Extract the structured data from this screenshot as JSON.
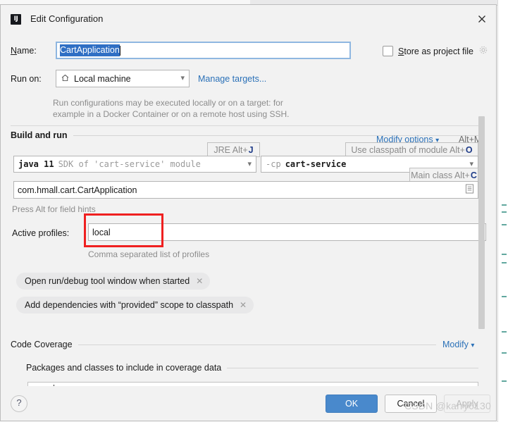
{
  "window": {
    "title": "Edit Configuration",
    "logo_text": "IJ",
    "close_icon": "close-icon"
  },
  "name_row": {
    "label_prefix": "N",
    "label_rest": "ame:",
    "value": "CartApplication",
    "placeholder": ""
  },
  "store_as_project_file": {
    "label_prefix": "S",
    "label_rest": "tore as project file",
    "checked": false,
    "gear_icon": "gear-icon"
  },
  "run_on": {
    "label": "Run on:",
    "value": "Local machine",
    "icon": "home-icon",
    "manage_targets_link": "Manage targets..."
  },
  "run_on_hint": {
    "line1": "Run configurations may be executed locally or on a target: for",
    "line2": "example in a Docker Container or on a remote host using SSH."
  },
  "build_and_run": {
    "section_title": "Build and run",
    "modify_options_link": "Modify options",
    "modify_options_shortcut": "Alt+M",
    "jre": {
      "bubble_label": "JRE Alt+",
      "bubble_key": "J",
      "value_bold": "java 11",
      "value_dim": "SDK of 'cart-service' module"
    },
    "classpath": {
      "bubble_label": "Use classpath of module Alt+",
      "bubble_key": "O",
      "value_dim": "-cp",
      "value_bold": "cart-service"
    },
    "main_class": {
      "bubble_label": "Main class Alt+",
      "bubble_key": "C",
      "value": "com.hmall.cart.CartApplication",
      "browse_icon": "document-browse-icon"
    },
    "field_hints": "Press Alt for field hints"
  },
  "active_profiles": {
    "label": "Active profiles:",
    "value": "local",
    "helper_text": "Comma separated list of profiles"
  },
  "chips": [
    {
      "label": "Open run/debug tool window when started",
      "remove_icon": "close-small-icon"
    },
    {
      "label": "Add dependencies with “provided” scope to classpath",
      "remove_icon": "close-small-icon"
    }
  ],
  "code_coverage": {
    "section_title": "Code Coverage",
    "modify_link": "Modify",
    "packages_label": "Packages and classes to include in coverage data"
  },
  "footer": {
    "help_label": "?",
    "ok_label": "OK",
    "cancel_label": "Cancel",
    "apply_label": "Apply"
  },
  "watermark": "CSDN @karry0130",
  "colors": {
    "accent_blue": "#4989cc",
    "link_blue": "#2b71b8",
    "selection_blue": "#2f6fc4",
    "annotation_red": "#ef2020",
    "dialog_bg": "#f2f2f2",
    "chip_bg": "#e8e8e9"
  }
}
